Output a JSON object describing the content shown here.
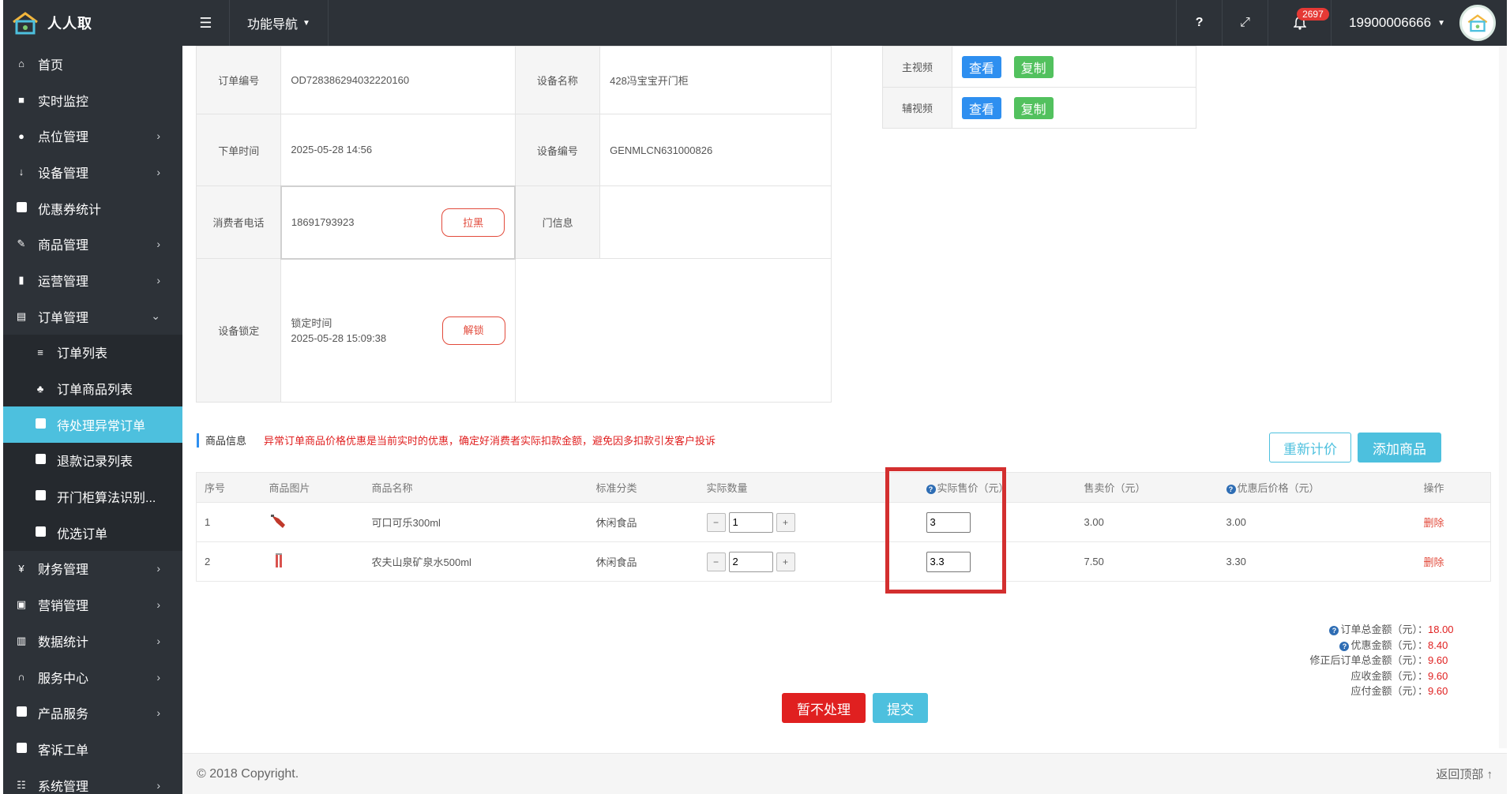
{
  "app": {
    "name": "人人取"
  },
  "topbar": {
    "nav_label": "功能导航",
    "help": "?",
    "notification_count": "2697",
    "user": "19900006666"
  },
  "sidebar": {
    "items": [
      {
        "label": "首页",
        "icon": "home-icon"
      },
      {
        "label": "实时监控",
        "icon": "video-camera-icon"
      },
      {
        "label": "点位管理",
        "icon": "map-pin-icon"
      },
      {
        "label": "设备管理",
        "icon": "sort-icon"
      },
      {
        "label": "优惠券统计",
        "icon": "square-icon"
      },
      {
        "label": "商品管理",
        "icon": "edit-icon"
      },
      {
        "label": "运营管理",
        "icon": "bookmark-icon"
      },
      {
        "label": "订单管理",
        "icon": "list-icon"
      }
    ],
    "sub_items": [
      {
        "label": "订单列表",
        "icon": "bars-icon"
      },
      {
        "label": "订单商品列表",
        "icon": "sitemap-icon"
      },
      {
        "label": "待处理异常订单",
        "icon": "square-icon"
      },
      {
        "label": "退款记录列表",
        "icon": "square-icon"
      },
      {
        "label": "开门柜算法识别...",
        "icon": "square-icon"
      },
      {
        "label": "优选订单",
        "icon": "square-icon"
      }
    ],
    "items_after": [
      {
        "label": "财务管理",
        "icon": "yen-icon"
      },
      {
        "label": "营销管理",
        "icon": "gift-icon"
      },
      {
        "label": "数据统计",
        "icon": "bar-chart-icon"
      },
      {
        "label": "服务中心",
        "icon": "headphones-icon"
      },
      {
        "label": "产品服务",
        "icon": "square-icon"
      },
      {
        "label": "客诉工单",
        "icon": "square-icon"
      },
      {
        "label": "系统管理",
        "icon": "table-icon"
      }
    ]
  },
  "order": {
    "order_no_label": "订单编号",
    "order_no": "OD728386294032220160",
    "device_name_label": "设备名称",
    "device_name": "428冯宝宝开门柜",
    "order_time_label": "下单时间",
    "order_time": "2025-05-28 14:56",
    "device_no_label": "设备编号",
    "device_no": "GENMLCN631000826",
    "phone_label": "消费者电话",
    "phone": "18691793923",
    "blacklist_btn": "拉黑",
    "door_info_label": "门信息",
    "door_info": "",
    "lock_label": "设备锁定",
    "lock_time_label": "锁定时间",
    "lock_time": "2025-05-28 15:09:38",
    "unlock_btn": "解锁"
  },
  "video": {
    "main_label": "主视频",
    "aux_label": "辅视频",
    "view_btn": "查看",
    "copy_btn": "复制"
  },
  "goods": {
    "section_title": "商品信息",
    "warning": "异常订单商品价格优惠是当前实时的优惠，确定好消费者实际扣款金额，避免因多扣款引发客户投诉",
    "reprice_btn": "重新计价",
    "add_btn": "添加商品",
    "columns": [
      "序号",
      "商品图片",
      "商品名称",
      "标准分类",
      "实际数量",
      "实际售价（元）",
      "售卖价（元）",
      "优惠后价格（元）",
      "操作"
    ],
    "rows": [
      {
        "no": "1",
        "name": "可口可乐300ml",
        "category": "休闲食品",
        "qty": "1",
        "actual_price": "3",
        "sale_price": "3.00",
        "discount_price": "3.00",
        "action": "删除"
      },
      {
        "no": "2",
        "name": "农夫山泉矿泉水500ml",
        "category": "休闲食品",
        "qty": "2",
        "actual_price": "3.3",
        "sale_price": "7.50",
        "discount_price": "3.30",
        "action": "删除"
      }
    ]
  },
  "summary": {
    "total_label": "订单总金额（元）：",
    "total": "18.00",
    "discount_label": "优惠金额（元）：",
    "discount": "8.40",
    "corrected_label": "修正后订单总金额（元）：",
    "corrected": "9.60",
    "receivable_label": "应收金额（元）：",
    "receivable": "9.60",
    "payable_label": "应付金额（元）：",
    "payable": "9.60"
  },
  "actions": {
    "hold_btn": "暂不处理",
    "submit_btn": "提交"
  },
  "footer": {
    "copyright": "© 2018 Copyright.",
    "back_top": "返回顶部"
  },
  "colors": {
    "sidebar_bg": "#2d3238",
    "accent": "#4dc0de",
    "danger": "#e02020",
    "primary": "#2e8ff0",
    "success": "#52c15e"
  }
}
